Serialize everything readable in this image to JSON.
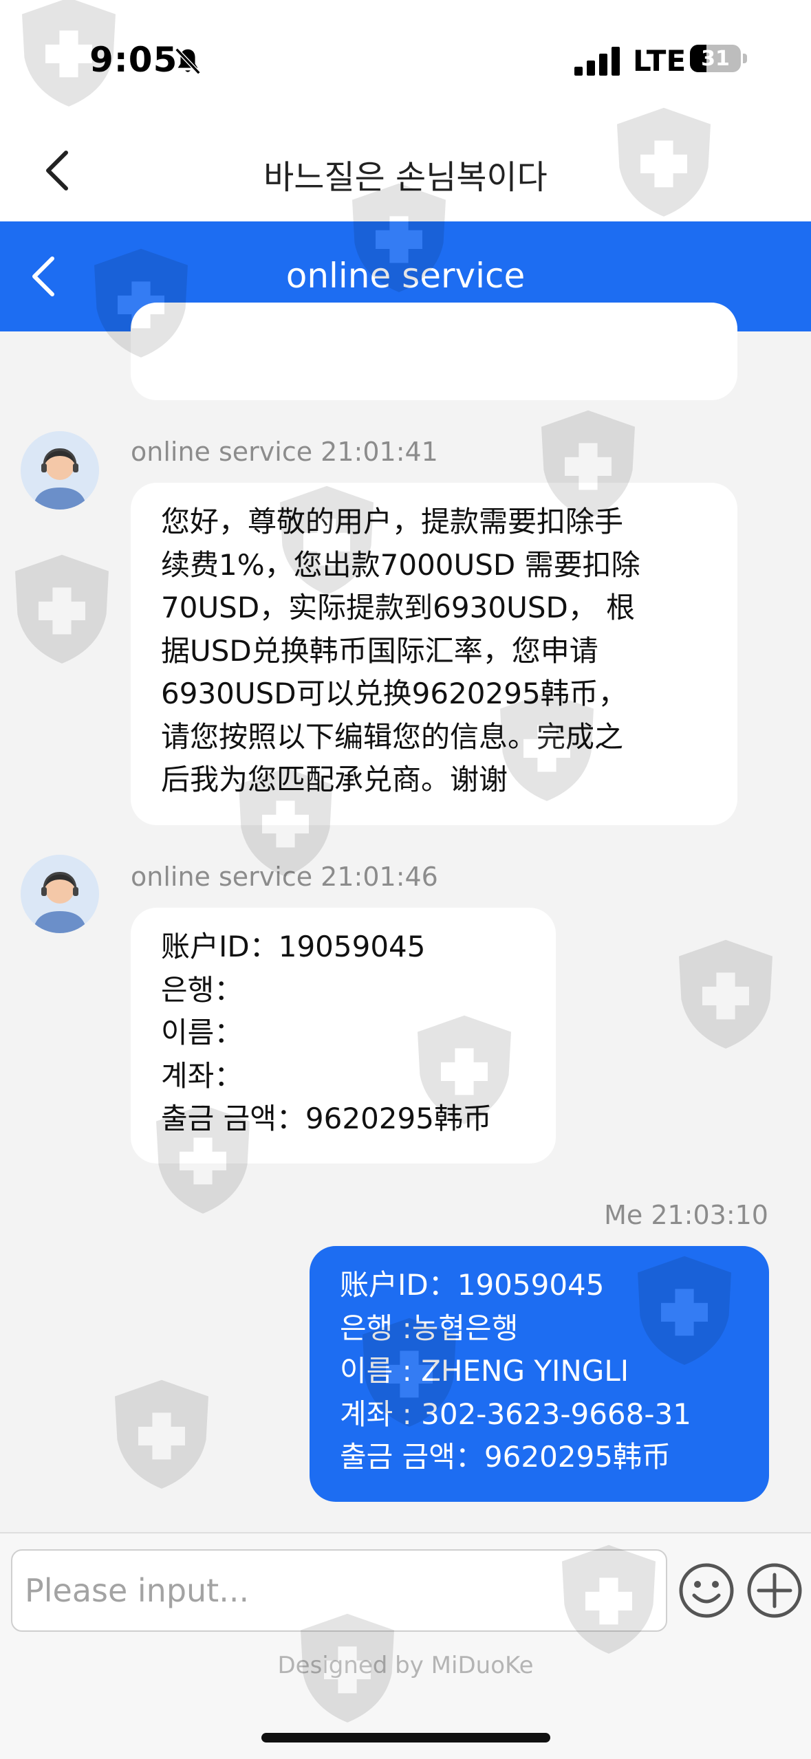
{
  "status_bar": {
    "time": "9:05",
    "network": "LTE",
    "battery_level": "31",
    "icons": [
      "bell-slash-icon",
      "signal-icon",
      "battery-icon"
    ]
  },
  "app_header": {
    "title": "바느질은 손님복이다",
    "back_icon": "chevron-left-icon"
  },
  "chat_header": {
    "title": "online service",
    "back_icon": "chevron-left-icon"
  },
  "messages": [
    {
      "sender": "online service",
      "time": "21:01:41",
      "meta": "online service 21:01:41",
      "lines": [
        "您好，尊敬的用户，提款需要扣除手",
        "续费1%，您出款7000USD 需要扣除",
        "70USD，实际提款到6930USD， 根",
        "据USD兑换韩币国际汇率，您申请",
        "6930USD可以兑换9620295韩币，",
        "请您按照以下编辑您的信息。完成之",
        "后我为您匹配承兑商。谢谢"
      ]
    },
    {
      "sender": "online service",
      "time": "21:01:46",
      "meta": "online service 21:01:46",
      "lines": [
        "账户ID：19059045",
        "은행：",
        "이름：",
        "계좌：",
        "출금 금액：9620295韩币"
      ]
    },
    {
      "sender": "Me",
      "time": "21:03:10",
      "meta": "Me 21:03:10",
      "lines": [
        "账户ID：19059045",
        "은행 :농협은행",
        "이름 : ZHENG YINGLI",
        "계좌 : 302-3623-9668-31",
        "출금 금액：9620295韩币"
      ]
    }
  ],
  "input_bar": {
    "placeholder": "Please input...",
    "emoji_icon": "smiley-icon",
    "plus_icon": "plus-circle-icon"
  },
  "footer": {
    "credit": "Designed by MiDuoKe"
  },
  "colors": {
    "accent": "#1d6df2",
    "bubble_other": "#ffffff",
    "bubble_me": "#1d6df2",
    "background": "#f3f3f3"
  }
}
